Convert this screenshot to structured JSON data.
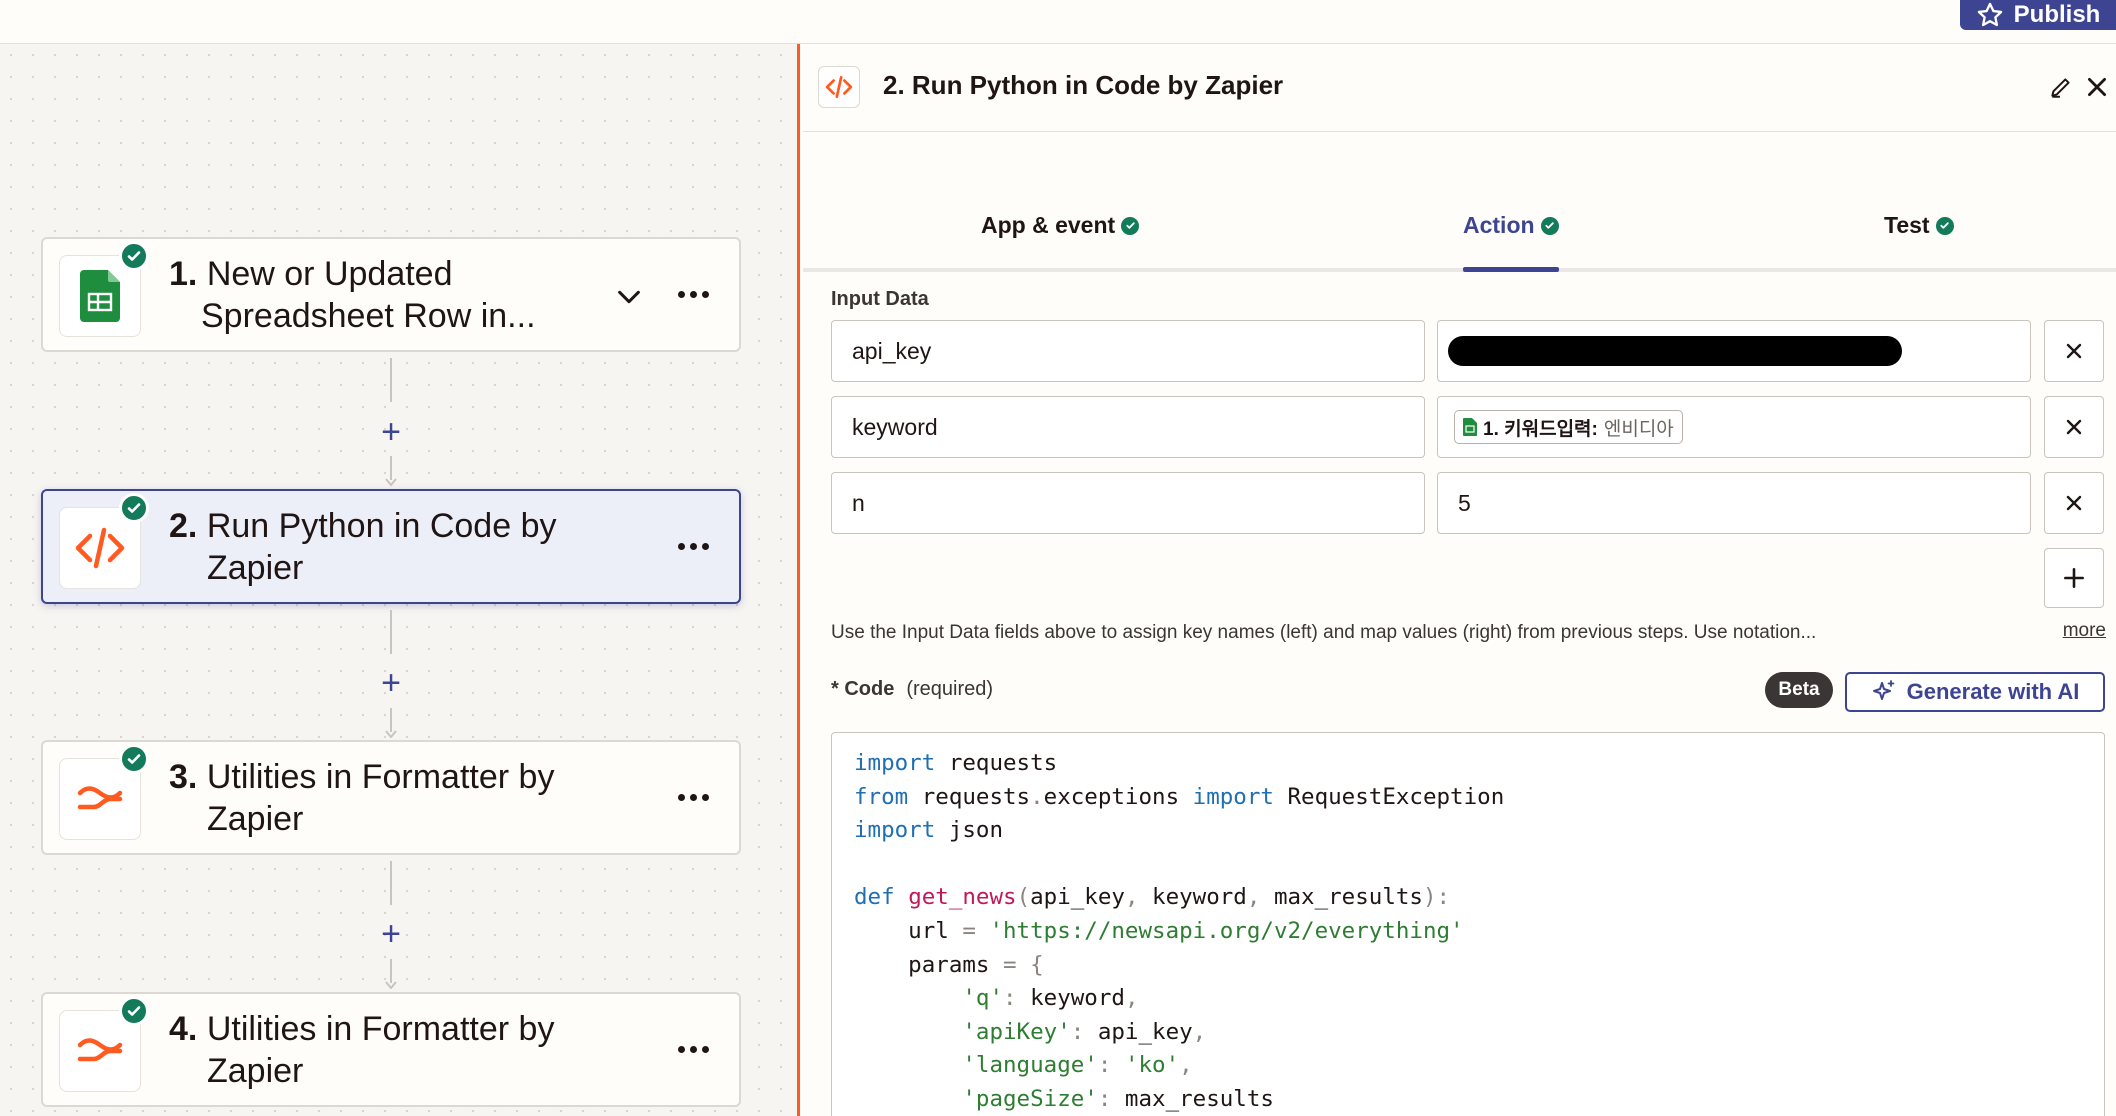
{
  "topbar": {
    "publish_label": "Publish"
  },
  "steps": [
    {
      "num": "1.",
      "line1": "New or Updated",
      "line2": "Spreadsheet Row in...",
      "app": "google-sheets-icon"
    },
    {
      "num": "2.",
      "line1": "Run Python in Code by",
      "line2": "Zapier",
      "app": "code-icon"
    },
    {
      "num": "3.",
      "line1": "Utilities in Formatter by",
      "line2": "Zapier",
      "app": "formatter-icon"
    },
    {
      "num": "4.",
      "line1": "Utilities in Formatter by",
      "line2": "Zapier",
      "app": "formatter-icon"
    }
  ],
  "panel": {
    "title": "2. Run Python in Code by Zapier",
    "tabs": [
      {
        "label": "App & event"
      },
      {
        "label": "Action"
      },
      {
        "label": "Test"
      }
    ],
    "input_data_label": "Input Data",
    "rows": [
      {
        "key": "api_key"
      },
      {
        "key": "keyword",
        "pill_label": "1. 키워드입력:",
        "pill_value": "엔비디아"
      },
      {
        "key": "n",
        "value": "5"
      }
    ],
    "help_text": "Use the Input Data fields above to assign key names (left) and map values (right) from previous steps. Use notation...",
    "more_label": "more",
    "code_label": "* Code",
    "code_required": "(required)",
    "beta_label": "Beta",
    "generate_label": "Generate with AI"
  },
  "colors": {
    "accent": "#3d4592",
    "success": "#137a5a",
    "zapier_orange": "#ff5a1f",
    "sheets_green": "#1e8e3e"
  }
}
